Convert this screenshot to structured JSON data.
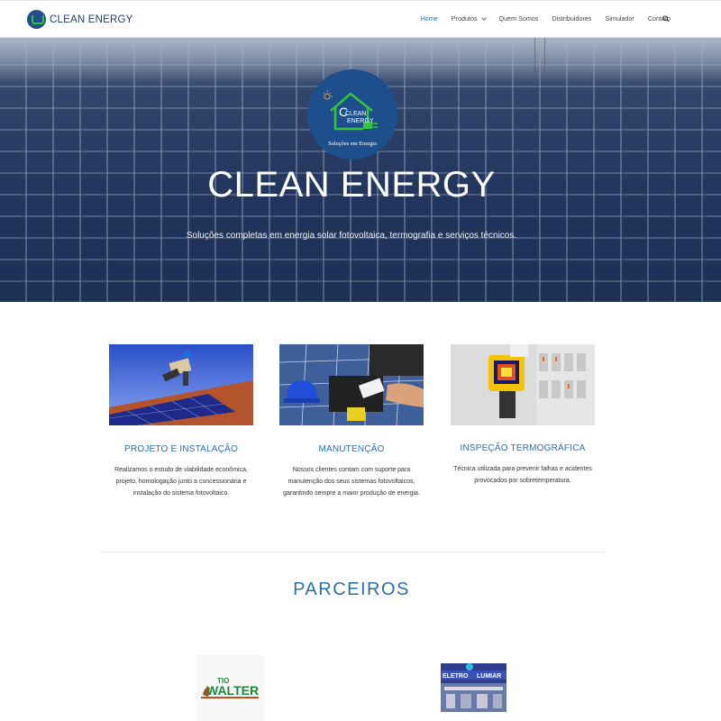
{
  "header": {
    "brand": "CLEAN ENERGY",
    "nav": [
      {
        "label": "Home",
        "active": true
      },
      {
        "label": "Produtos",
        "dropdown": true
      },
      {
        "label": "Quem Somos"
      },
      {
        "label": "Distribuidores"
      },
      {
        "label": "Simulador"
      },
      {
        "label": "Contato"
      }
    ]
  },
  "hero": {
    "logo_text_line1": "CLEAN",
    "logo_text_line2": "ENERGY",
    "logo_tagline": "Soluções em Energia",
    "title": "CLEAN ENERGY",
    "subtitle": "Soluções completas em energia solar fotovoltaica, termografia e serviços técnicos."
  },
  "services": [
    {
      "title": "PROJETO E INSTALAÇÃO",
      "text": "Realizamos o estudo de viabilidade econômica, projeto, homologação junto a concessionária e instalação do sistema fotovoltaico."
    },
    {
      "title": "MANUTENÇÃO",
      "text": "Nossos clientes contam com suporte para manutenção dos seus sistemas fotovoltaicos, garantindo sempre a maior produção de energia."
    },
    {
      "title": "INSPEÇÃO TERMOGRÁFICA",
      "text": "Técnica utilizada para prevenir falhas e acidentes provocados por sobretemperatura."
    }
  ],
  "partners": {
    "title": "PARCEIROS",
    "items": [
      {
        "name_line1": "TIO",
        "name_line2": "WALTER"
      },
      {
        "name_line1": "ELETRO",
        "name_line2": "LUMIAR"
      }
    ]
  },
  "colors": {
    "accent": "#2a6fb0",
    "brand_blue": "#1f4f8a",
    "brand_green": "#2fbf3a"
  }
}
